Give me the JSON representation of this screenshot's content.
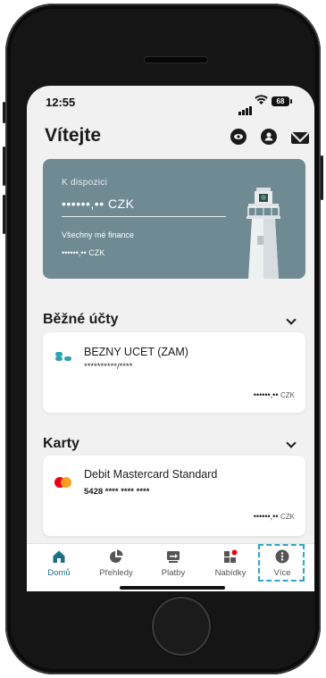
{
  "status_bar": {
    "time": "12:55",
    "battery": "68"
  },
  "header": {
    "title": "Vítejte"
  },
  "balance_card": {
    "available_label": "K dispozici",
    "available_amount": "••••••,•• CZK",
    "finances_label": "Všechny mé finance",
    "finances_amount": "••••••,•• CZK"
  },
  "current_accounts": {
    "title": "Běžné účty",
    "items": [
      {
        "name": "BEZNY UCET (ZAM)",
        "number": "**********/****",
        "balance": "••••••,••",
        "currency": "CZK"
      }
    ]
  },
  "cards": {
    "title": "Karty",
    "items": [
      {
        "name": "Debit Mastercard Standard",
        "number": "5428 **** **** ****",
        "balance": "••••••,••",
        "currency": "CZK"
      }
    ]
  },
  "tab_bar": {
    "items": [
      {
        "label": "Domů",
        "active": true
      },
      {
        "label": "Přehledy"
      },
      {
        "label": "Platby"
      },
      {
        "label": "Nabídky"
      },
      {
        "label": "Více"
      }
    ]
  },
  "colors": {
    "accent": "#1d6f86",
    "highlight": "#2aa6c8",
    "card_bg": "#6f8a93",
    "notification": "#e30613"
  }
}
